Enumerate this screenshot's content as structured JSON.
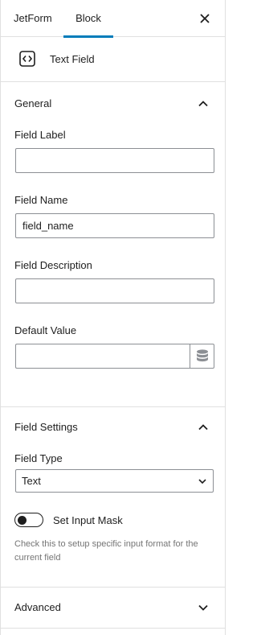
{
  "tabs": {
    "jetform": "JetForm",
    "block": "Block"
  },
  "block": {
    "title": "Text Field",
    "icon": "code-brackets-icon"
  },
  "general": {
    "title": "General",
    "field_label": {
      "label": "Field Label",
      "value": ""
    },
    "field_name": {
      "label": "Field Name",
      "value": "field_name"
    },
    "field_description": {
      "label": "Field Description",
      "value": ""
    },
    "default_value": {
      "label": "Default Value",
      "value": "",
      "icon": "database-icon"
    }
  },
  "field_settings": {
    "title": "Field Settings",
    "field_type": {
      "label": "Field Type",
      "value": "Text"
    },
    "input_mask": {
      "label": "Set Input Mask",
      "enabled": false,
      "help": "Check this to setup specific input format for the current field"
    }
  },
  "advanced": {
    "title": "Advanced"
  },
  "colors": {
    "accent": "#007cba",
    "border": "#e0e0e0",
    "input_border": "#8c8f94",
    "help_text": "#757575"
  }
}
